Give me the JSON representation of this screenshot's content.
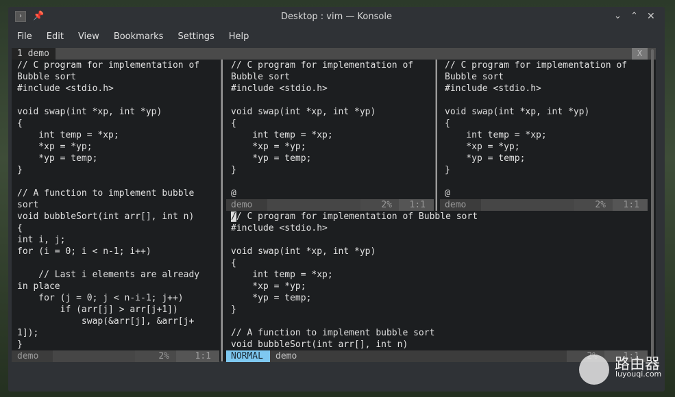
{
  "window": {
    "title": "Desktop : vim — Konsole",
    "icons": [
      "konsole-app-icon",
      "pin-icon",
      "minimize-chevron-down-icon",
      "maximize-chevron-up-icon",
      "close-icon"
    ]
  },
  "menu": [
    "File",
    "Edit",
    "View",
    "Bookmarks",
    "Settings",
    "Help"
  ],
  "tabs": {
    "active": "1 demo",
    "close": "X"
  },
  "panes": {
    "left": {
      "lines": [
        "// C program for implementation of",
        "Bubble sort",
        "#include <stdio.h>",
        "",
        "void swap(int *xp, int *yp)",
        "{",
        "    int temp = *xp;",
        "    *xp = *yp;",
        "    *yp = temp;",
        "}",
        "",
        "// A function to implement bubble",
        "sort",
        "void bubbleSort(int arr[], int n)",
        "{",
        "int i, j;",
        "for (i = 0; i < n-1; i++)",
        "",
        "    // Last i elements are already",
        "in place",
        "    for (j = 0; j < n-i-1; j++)",
        "        if (arr[j] > arr[j+1])",
        "            swap(&arr[j], &arr[j+",
        "1]);",
        "}"
      ],
      "status": {
        "name": "demo",
        "percent": "2%",
        "pos": "1:1"
      }
    },
    "top_middle": {
      "lines": [
        "// C program for implementation of",
        "Bubble sort",
        "#include <stdio.h>",
        "",
        "void swap(int *xp, int *yp)",
        "{",
        "    int temp = *xp;",
        "    *xp = *yp;",
        "    *yp = temp;",
        "}",
        "",
        "@"
      ],
      "status": {
        "name": "demo",
        "percent": "2%",
        "pos": "1:1"
      }
    },
    "top_right": {
      "lines": [
        "// C program for implementation of",
        "Bubble sort",
        "#include <stdio.h>",
        "",
        "void swap(int *xp, int *yp)",
        "{",
        "    int temp = *xp;",
        "    *xp = *yp;",
        "    *yp = temp;",
        "}",
        "",
        "@"
      ],
      "status": {
        "name": "demo",
        "percent": "2%",
        "pos": "1:1"
      }
    },
    "bottom": {
      "cursor_char": "/",
      "first_rest": "/ C program for implementation of Bubble sort",
      "lines": [
        "#include <stdio.h>",
        "",
        "void swap(int *xp, int *yp)",
        "{",
        "    int temp = *xp;",
        "    *xp = *yp;",
        "    *yp = temp;",
        "}",
        "",
        "// A function to implement bubble sort",
        "void bubbleSort(int arr[], int n)"
      ],
      "status": {
        "mode": "NORMAL",
        "name": "demo",
        "percent": "2%",
        "pos": "1:1"
      }
    }
  },
  "colors": {
    "mode_badge": "#7ec8f0",
    "terminal_bg": "#1c1e20"
  },
  "watermark": {
    "text": "路由器",
    "url": "luyouqi.com"
  }
}
